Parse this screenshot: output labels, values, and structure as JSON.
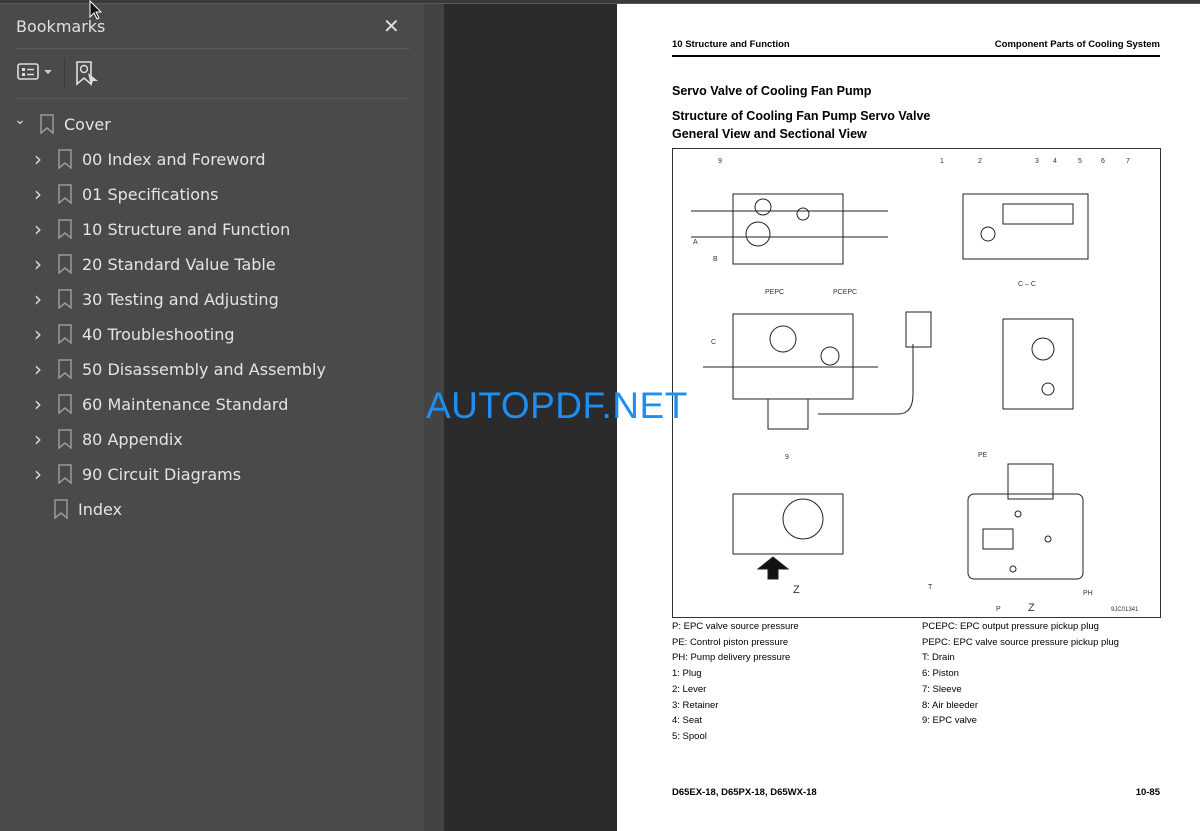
{
  "sidebar": {
    "title": "Bookmarks",
    "close_icon": "close-icon",
    "options_icon": "list-options-icon",
    "find_bookmark_icon": "find-current-bookmark-icon",
    "items": [
      {
        "label": "Cover",
        "expanded": true,
        "level": 0
      },
      {
        "label": "00 Index and Foreword",
        "level": 1
      },
      {
        "label": "01 Specifications",
        "level": 1
      },
      {
        "label": "10 Structure and Function",
        "level": 1
      },
      {
        "label": "20 Standard Value Table",
        "level": 1
      },
      {
        "label": "30 Testing and Adjusting",
        "level": 1
      },
      {
        "label": "40 Troubleshooting",
        "level": 1
      },
      {
        "label": "50 Disassembly and Assembly",
        "level": 1
      },
      {
        "label": "60 Maintenance Standard",
        "level": 1
      },
      {
        "label": "80 Appendix",
        "level": 1
      },
      {
        "label": "90 Circuit Diagrams",
        "level": 1
      },
      {
        "label": "Index",
        "level": 1,
        "leaf": true
      }
    ]
  },
  "page": {
    "header_left": "10 Structure and Function",
    "header_right": "Component Parts of Cooling System",
    "title": "Servo Valve of Cooling Fan Pump",
    "subtitle": "Structure of Cooling Fan Pump Servo Valve",
    "subtitle2": "General View and Sectional View",
    "figure": {
      "labels": {
        "n9": "9",
        "n1": "1",
        "n2": "2",
        "n3": "3",
        "n4": "4",
        "n5": "5",
        "n6": "6",
        "n7": "7",
        "a": "A",
        "b": "B",
        "c": "C",
        "cc": "C – C",
        "pepc": "PEPC",
        "pcepc": "PCEPC",
        "pe": "PE",
        "t": "T",
        "ph": "PH",
        "p": "P",
        "z": "Z",
        "code": "9JC01341"
      }
    },
    "legend_left": [
      "P: EPC valve source pressure",
      "PE: Control piston pressure",
      "PH: Pump delivery pressure",
      "1: Plug",
      "2: Lever",
      "3: Retainer",
      "4: Seat",
      "5: Spool"
    ],
    "legend_right": [
      "PCEPC: EPC output pressure pickup plug",
      "PEPC: EPC valve source pressure pickup plug",
      "T: Drain",
      "6: Piston",
      "7: Sleeve",
      "8: Air bleeder",
      "9: EPC valve"
    ],
    "footer_left": "D65EX-18, D65PX-18, D65WX-18",
    "footer_right": "10-85"
  },
  "watermark": "AUTOPDF.NET",
  "colors": {
    "watermark": "#1e8ff0",
    "sidebar": "#4a4a4a",
    "viewer": "#2b2b2b"
  }
}
